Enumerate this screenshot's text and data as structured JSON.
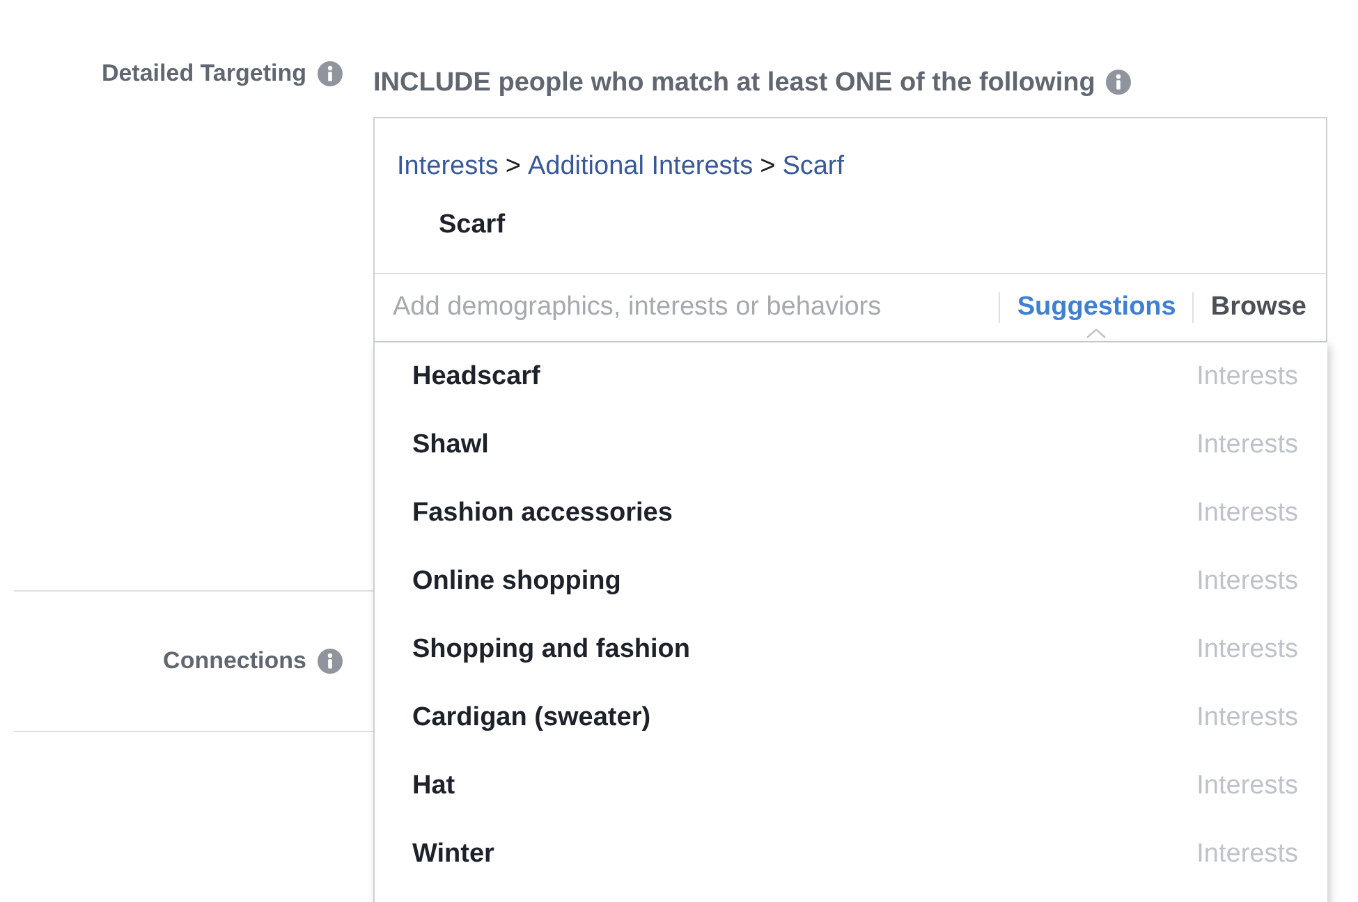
{
  "detailed_targeting": {
    "label": "Detailed Targeting",
    "heading": "INCLUDE people who match at least ONE of the following",
    "breadcrumb": {
      "items": [
        "Interests",
        "Additional Interests",
        "Scarf"
      ],
      "separators": [
        ">",
        ">"
      ]
    },
    "selected_items": [
      "Scarf"
    ],
    "search": {
      "placeholder": "Add demographics, interests or behaviors"
    },
    "tabs": [
      {
        "label": "Suggestions",
        "selected": true
      },
      {
        "label": "Browse",
        "selected": false
      }
    ],
    "suggestions": [
      {
        "name": "Headscarf",
        "category": "Interests"
      },
      {
        "name": "Shawl",
        "category": "Interests"
      },
      {
        "name": "Fashion accessories",
        "category": "Interests"
      },
      {
        "name": "Online shopping",
        "category": "Interests"
      },
      {
        "name": "Shopping and fashion",
        "category": "Interests"
      },
      {
        "name": "Cardigan (sweater)",
        "category": "Interests"
      },
      {
        "name": "Hat",
        "category": "Interests"
      },
      {
        "name": "Winter",
        "category": "Interests"
      }
    ]
  },
  "connections": {
    "label": "Connections"
  }
}
